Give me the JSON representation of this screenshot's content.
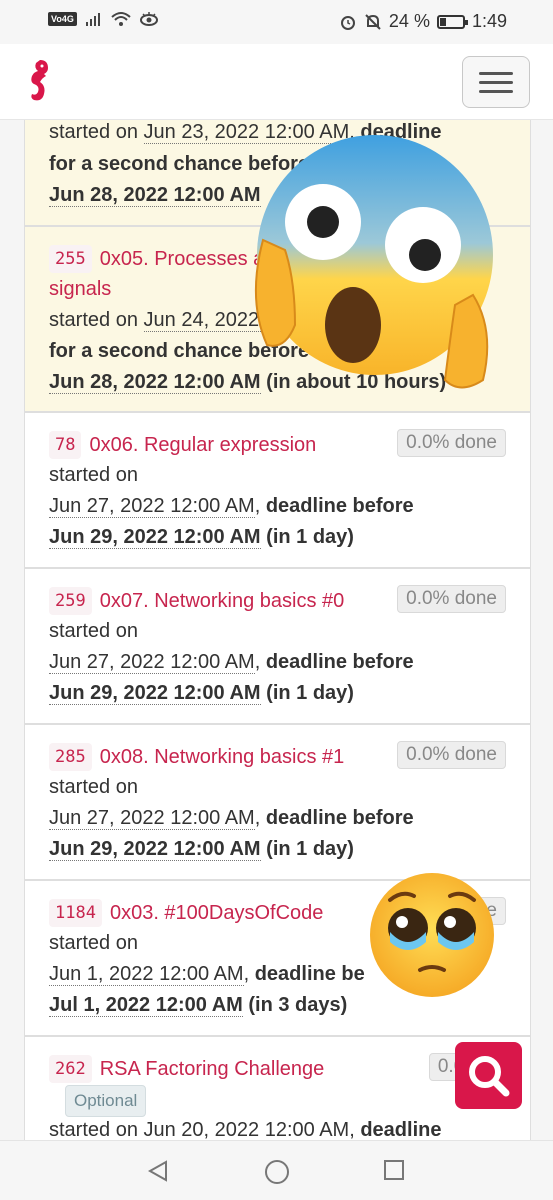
{
  "status_bar": {
    "carrier_badge": "Vo4G",
    "battery_percent": "24 %",
    "time": "1:49",
    "battery_level": 0.24
  },
  "app": {
    "menu_icon": "hamburger-menu-icon",
    "logo_icon": "seahorse-logo-icon",
    "accent_color": "#c7254e"
  },
  "projects": [
    {
      "id": "",
      "title": "",
      "line1": "started on ",
      "started": "Jun 23, 2022 12:00 AM",
      "deadline_text": "deadline",
      "line2": "for a second chance before",
      "deadline_date": "Jun 28, 2022 12:00 AM",
      "relative": "",
      "status": "warning"
    },
    {
      "id": "255",
      "title": "0x05. Processes and signals",
      "title_part1": "0x05. Processes and",
      "title_part2": "signals",
      "line1": "started on ",
      "started": "Jun 24, 2022 12:00 AM",
      "line2": "for a second chance before",
      "deadline_date": "Jun 28, 2022 12:00 AM",
      "relative": "(in about 10 hours)",
      "relative_visible": "(in about 1",
      "relative_tail": "urs)",
      "status": "warning"
    },
    {
      "id": "78",
      "title": "0x06. Regular expression",
      "progress": "0.0% done",
      "line1": "started on",
      "started": "Jun 27, 2022 12:00 AM",
      "deadline_label": "deadline before",
      "deadline_date": "Jun 29, 2022 12:00 AM",
      "relative": "(in 1 day)"
    },
    {
      "id": "259",
      "title": "0x07. Networking basics #0",
      "progress": "0.0% done",
      "line1": "started on",
      "started": "Jun 27, 2022 12:00 AM",
      "deadline_label": "deadline before",
      "deadline_date": "Jun 29, 2022 12:00 AM",
      "relative": "(in 1 day)"
    },
    {
      "id": "285",
      "title": "0x08. Networking basics #1",
      "progress": "0.0% done",
      "line1": "started on",
      "started": "Jun 27, 2022 12:00 AM",
      "deadline_label": "deadline before",
      "deadline_date": "Jun 29, 2022 12:00 AM",
      "relative": "(in 1 day)"
    },
    {
      "id": "1184",
      "title": "0x03. #100DaysOfCode",
      "progress": "0.0% done",
      "line1": "started on",
      "started": "Jun 1, 2022 12:00 AM",
      "deadline_label": "deadline be",
      "deadline_date": "Jul 1, 2022 12:00 AM",
      "relative": "(in 3 days)"
    },
    {
      "id": "262",
      "title": "RSA Factoring Challenge",
      "progress": "0.0% d",
      "tag": "Optional",
      "line1": "started on Jun 20, 2022 12:00 AM,",
      "deadline_label": "deadline"
    }
  ],
  "fab": {
    "icon": "search-icon"
  },
  "bottom_nav": [
    "back-icon",
    "home-icon",
    "recents-icon"
  ],
  "overlays": [
    "screaming-face-emoji",
    "pleading-face-emoji"
  ]
}
